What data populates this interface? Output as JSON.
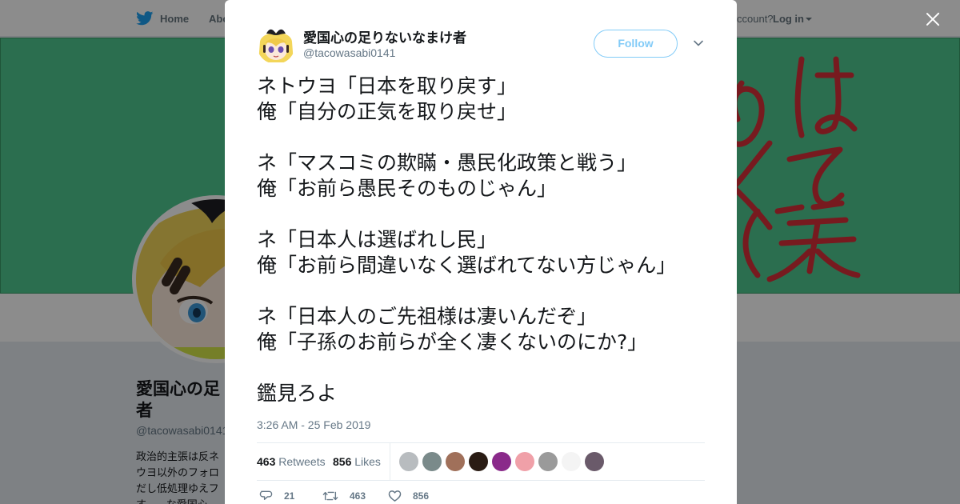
{
  "nav": {
    "home_label": "Home",
    "about_label": "Abo",
    "account_prompt": "ccount?",
    "login_label": "Log in"
  },
  "profile": {
    "name": "愛国心の足りないなまけ者",
    "name_visible": "愛国心の足",
    "name_line2": "者",
    "handle": "@tacowasabi0141",
    "bio_lines": [
      "政治的主張は反ネ",
      "ウヨ以外のフォロ",
      "だし低処理ゆえフ",
      "す。…な愛国心"
    ],
    "banner_text": [
      "のは",
      "くて",
      "(笑"
    ]
  },
  "tweet": {
    "author_name": "愛国心の足りないなまけ者",
    "author_handle": "@tacowasabi0141",
    "follow_label": "Follow",
    "lines": [
      "ネトウヨ「日本を取り戻す」",
      "俺「自分の正気を取り戻せ」",
      "",
      "ネ「マスコミの欺瞞・愚民化政策と戦う」",
      "俺「お前ら愚民そのものじゃん」",
      "",
      "ネ「日本人は選ばれし民」",
      "俺「お前ら間違いなく選ばれてない方じゃん」",
      "",
      "ネ「日本人のご先祖様は凄いんだぞ」",
      "俺「子孫のお前らが全く凄くないのにか?」",
      "",
      "鑑見ろよ"
    ],
    "timestamp": "3:26 AM - 25 Feb 2019",
    "retweets_count": "463",
    "retweets_label": "Retweets",
    "likes_count": "856",
    "likes_label": "Likes",
    "reply_count": "21",
    "retweet_action_count": "463",
    "like_action_count": "856"
  },
  "liker_avatars": [
    {
      "name": "liker-avatar-1",
      "color": "#b8bcbf"
    },
    {
      "name": "liker-avatar-2",
      "color": "#7a8a8a"
    },
    {
      "name": "liker-avatar-3",
      "color": "#a0705a"
    },
    {
      "name": "liker-avatar-4",
      "color": "#2a1c14"
    },
    {
      "name": "liker-avatar-5",
      "color": "#8a2a8a"
    },
    {
      "name": "liker-avatar-6",
      "color": "#f0a0a8"
    },
    {
      "name": "liker-avatar-7",
      "color": "#9a9a9a"
    },
    {
      "name": "liker-avatar-8",
      "color": "#f4f4f4"
    },
    {
      "name": "liker-avatar-9",
      "color": "#6a5a6a"
    }
  ],
  "colors": {
    "accent": "#1da1f2",
    "banner": "#4fc890",
    "banner_text": "#d9303a",
    "overlay": "rgba(0,0,0,0.45)"
  }
}
